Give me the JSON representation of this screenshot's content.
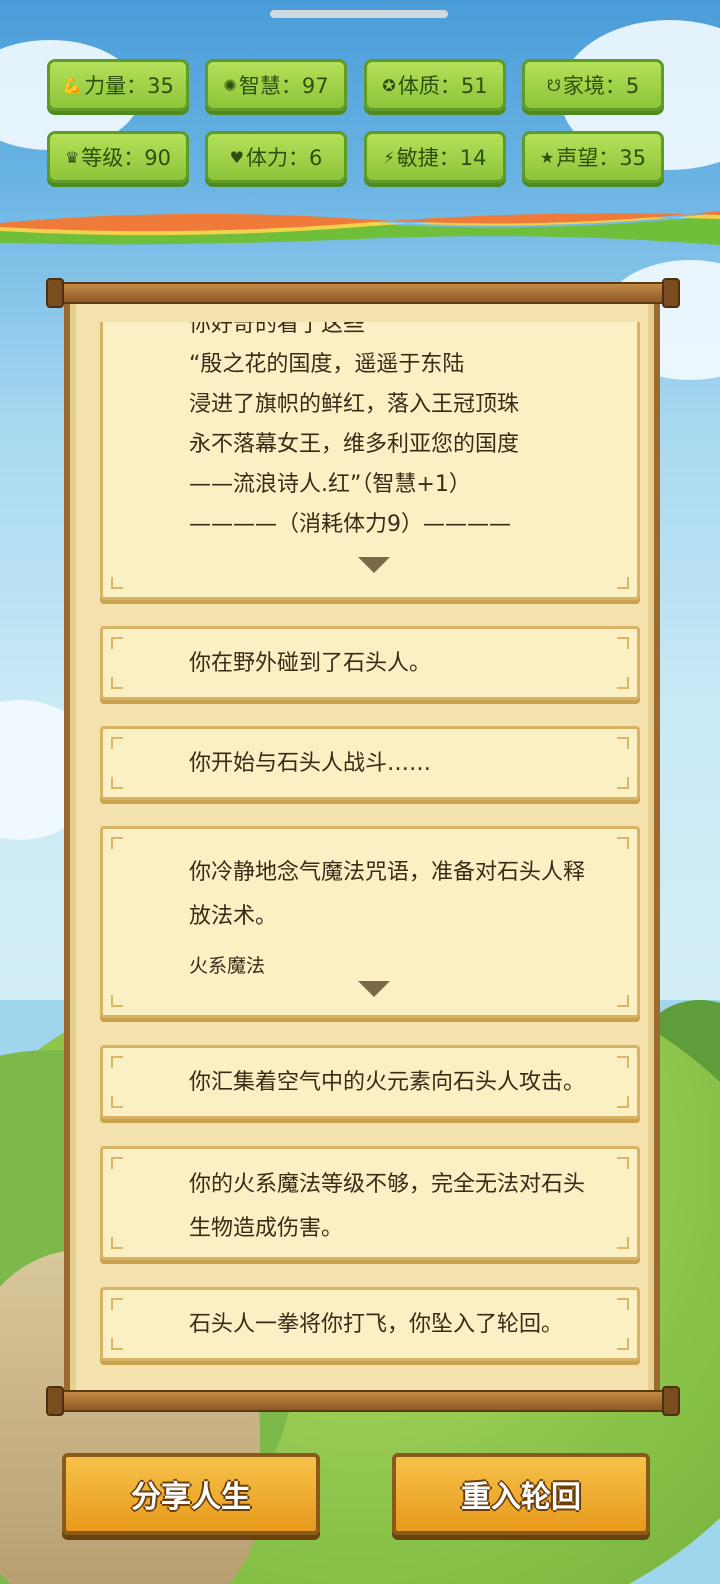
{
  "stats": [
    {
      "icon": "muscle-icon",
      "glyph": "💪",
      "label": "力量：35"
    },
    {
      "icon": "lightbulb-icon",
      "glyph": "✺",
      "label": "智慧：97"
    },
    {
      "icon": "body-icon",
      "glyph": "✪",
      "label": "体质：51"
    },
    {
      "icon": "family-icon",
      "glyph": "☋",
      "label": "家境：5"
    },
    {
      "icon": "crown-icon",
      "glyph": "♛",
      "label": "等级：90"
    },
    {
      "icon": "heart-icon",
      "glyph": "♥",
      "label": "体力：6"
    },
    {
      "icon": "lightning-icon",
      "glyph": "⚡",
      "label": "敏捷：14"
    },
    {
      "icon": "star-icon",
      "glyph": "★",
      "label": "声望：35"
    }
  ],
  "log": {
    "card0": {
      "clipped_top": "你好奇的看了这些",
      "lines": [
        "“殷之花的国度，遥遥于东陆",
        "浸进了旗帜的鲜红，落入王冠顶珠",
        "永不落幕女王，维多利亚您的国度",
        "——流浪诗人.红”（智慧+1）",
        "————（消耗体力9）————"
      ],
      "expand_icon": "triangle-down-icon"
    },
    "card1": "你在野外碰到了石头人。",
    "card2": "你开始与石头人战斗……",
    "card3": {
      "lines": [
        "你冷静地念气魔法咒语，准备对石头人释",
        "放法术。"
      ],
      "sub": "火系魔法",
      "expand_icon": "triangle-down-icon"
    },
    "card4": "你汇集着空气中的火元素向石头人攻击。",
    "card5": {
      "lines": [
        "你的火系魔法等级不够，完全无法对石头",
        "生物造成伤害。"
      ]
    },
    "card6": "石头人一拳将你打飞，你坠入了轮回。"
  },
  "buttons": {
    "share": "分享人生",
    "rebirth": "重入轮回"
  },
  "colors": {
    "stat_green": "#9ccf46",
    "parchment": "#fbefc4",
    "button_orange": "#efab2c",
    "wood": "#9b6a30"
  }
}
